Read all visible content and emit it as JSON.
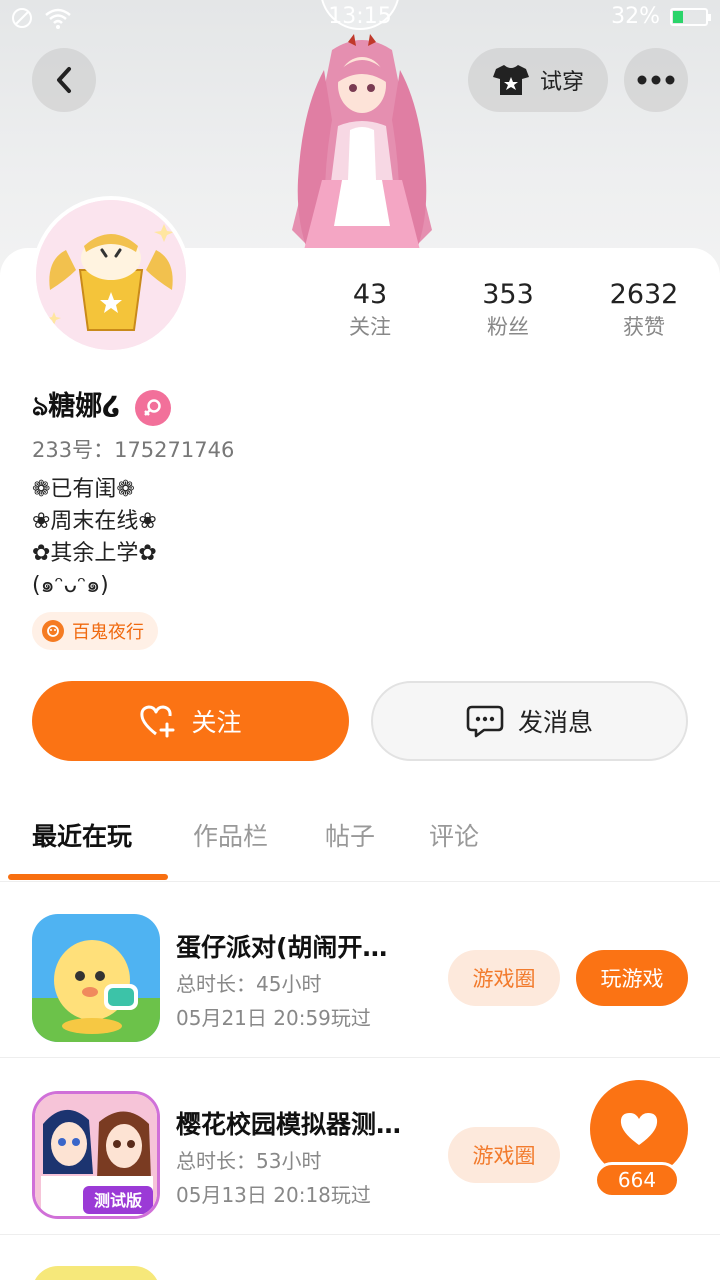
{
  "status_bar": {
    "time": "13:15",
    "battery": "32%",
    "battery_level": 0.32
  },
  "header": {
    "back_icon": "chevron-left-icon",
    "tryon_label": "试穿",
    "tryon_icon": "tshirt-icon",
    "more_icon": "more-dots-icon"
  },
  "profile": {
    "nickname": "ঌ糖娜໒",
    "gender": "female",
    "uid": "233号：175271746",
    "bio": [
      "❁已有闺❁",
      "❀周末在线❀",
      "✿其余上学✿",
      "(๑ᵔᴗᵔ๑)"
    ],
    "badge": "百鬼夜行"
  },
  "stats": [
    {
      "value": "43",
      "label": "关注"
    },
    {
      "value": "353",
      "label": "粉丝"
    },
    {
      "value": "2632",
      "label": "获赞"
    }
  ],
  "actions": {
    "follow_label": "关注",
    "message_label": "发消息"
  },
  "tabs": [
    {
      "label": "最近在玩",
      "active": true
    },
    {
      "label": "作品栏",
      "active": false
    },
    {
      "label": "帖子",
      "active": false
    },
    {
      "label": "评论",
      "active": false
    }
  ],
  "games": [
    {
      "title": "蛋仔派对(胡闹开…",
      "duration": "总时长：45小时",
      "last_played": "05月21日 20:59玩过",
      "circle_label": "游戏圈",
      "play_label": "玩游戏"
    },
    {
      "title": "樱花校园模拟器测…",
      "duration": "总时长：53小时",
      "last_played": "05月13日 20:18玩过",
      "circle_label": "游戏圈",
      "icon_label": "测试版"
    }
  ],
  "like_fab": {
    "count": "664"
  },
  "colors": {
    "accent": "#fb7314",
    "gender_female": "#f2709a"
  }
}
